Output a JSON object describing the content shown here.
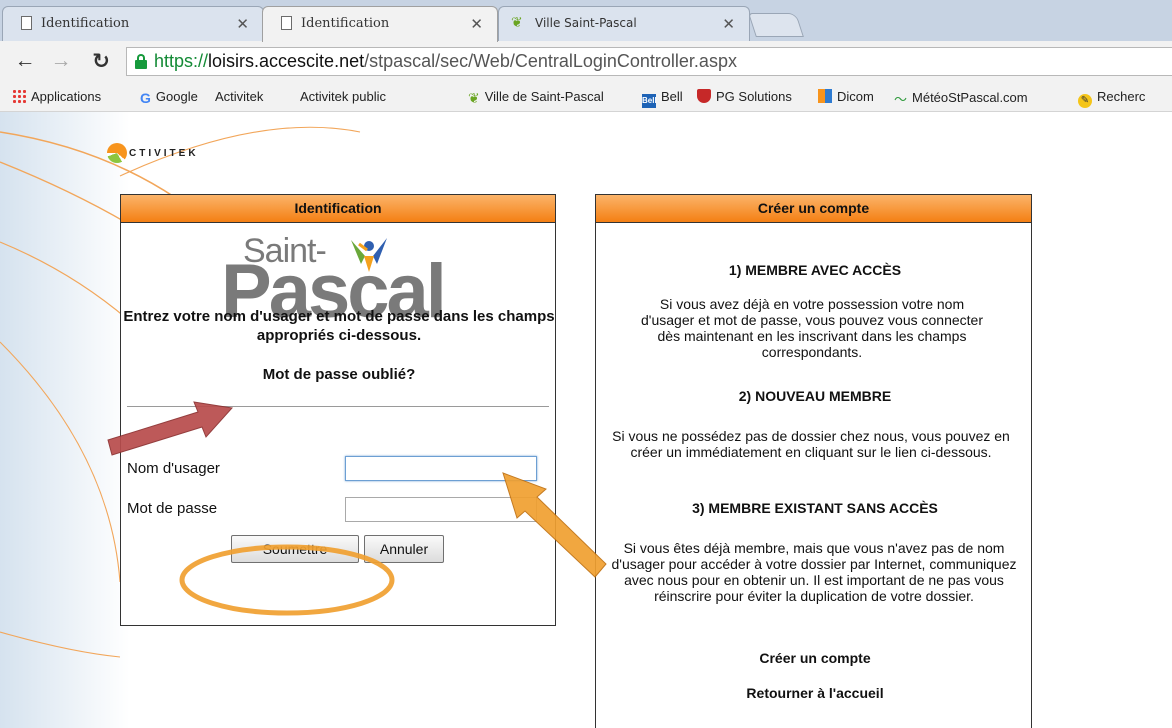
{
  "browser": {
    "tabs": [
      {
        "title": "Identification",
        "active": false
      },
      {
        "title": "Identification",
        "active": true
      },
      {
        "title": "Ville Saint-Pascal",
        "active": false
      }
    ],
    "url": {
      "scheme": "https://",
      "host": "loisirs.accescite.net",
      "path": "/stpascal/sec/Web/CentralLoginController.aspx"
    },
    "bookmarks": [
      {
        "label": "Applications",
        "icon": "apps-grid-icon"
      },
      {
        "label": "Google",
        "icon": "google-icon"
      },
      {
        "label": "Activitek",
        "icon": "page-icon"
      },
      {
        "label": "Activitek public",
        "icon": "page-icon"
      },
      {
        "label": "Ville de Saint-Pascal",
        "icon": "leaf-icon"
      },
      {
        "label": "Bell",
        "icon": "bell-icon"
      },
      {
        "label": "PG Solutions",
        "icon": "shield-icon"
      },
      {
        "label": "Dicom",
        "icon": "dicom-icon"
      },
      {
        "label": "MétéoStPascal.com",
        "icon": "meteo-icon"
      },
      {
        "label": "Recherc",
        "icon": "search-icon"
      }
    ]
  },
  "site": {
    "logo_text": "CTIVITEK"
  },
  "login": {
    "header": "Identification",
    "logo_saint": "Saint-",
    "logo_pascal": "Pascal",
    "instructions": "Entrez votre nom d'usager et mot de passe dans les champs appropriés ci-dessous.",
    "forgot_link": "Mot de passe oublié?",
    "username_label": "Nom d'usager",
    "username_value": "",
    "password_label": "Mot de passe",
    "password_value": "",
    "submit_label": "Soumettre",
    "cancel_label": "Annuler"
  },
  "register": {
    "header": "Créer un compte",
    "s1_title": "1) MEMBRE AVEC ACCÈS",
    "s1_text": "Si vous avez déjà en votre possession votre nom d'usager et mot de passe, vous pouvez vous connecter dès maintenant en les inscrivant dans les champs correspondants.",
    "s2_title": "2) NOUVEAU MEMBRE",
    "s2_text": "Si vous ne possédez pas de dossier chez nous, vous pouvez en créer un immédiatement en cliquant sur le lien ci-dessous.",
    "s3_title": "3) MEMBRE EXISTANT SANS ACCÈS",
    "s3_text": "Si vous êtes déjà membre, mais que vous n'avez pas de nom d'usager pour accéder à votre dossier par Internet, communiquez avec nous pour en obtenir un. Il est important de ne pas vous réinscrire pour éviter la duplication de votre dossier.",
    "create_link": "Créer un compte",
    "home_link": "Retourner à l'accueil"
  },
  "colors": {
    "header_orange": "#f47f13",
    "annotation_orange": "#f0a030",
    "annotation_red": "#b84c4c",
    "secure_green": "#169a3c"
  }
}
